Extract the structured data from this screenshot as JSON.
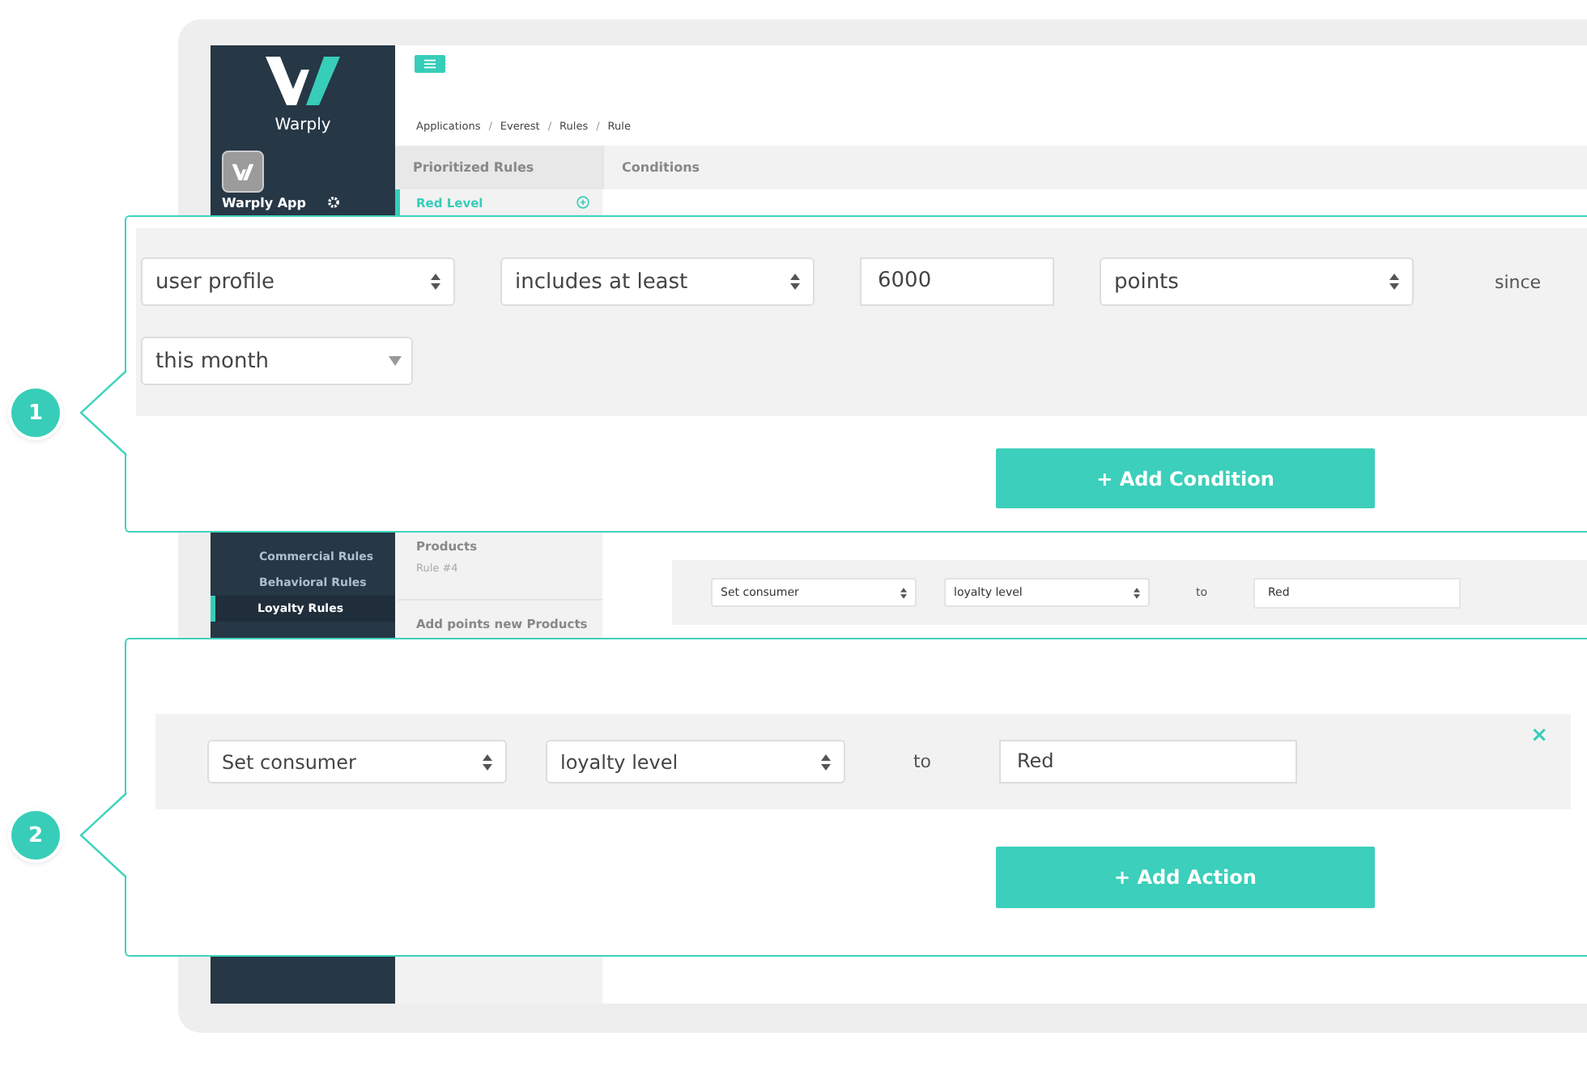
{
  "sidebar": {
    "brand": "Warply",
    "app": {
      "name": "Warply App"
    },
    "items": [
      {
        "label": "Commercial Rules",
        "selected": false
      },
      {
        "label": "Behavioral Rules",
        "selected": false
      },
      {
        "label": "Loyalty Rules",
        "selected": true
      }
    ]
  },
  "breadcrumb": {
    "separator": "/",
    "items": [
      "Applications",
      "Everest",
      "Rules",
      "Rule"
    ]
  },
  "rules_panel": {
    "title": "Prioritized Rules",
    "rules": [
      {
        "title": "Red Level",
        "selected": true
      },
      {
        "title": "Products",
        "subtitle": "Rule #4",
        "selected": false
      },
      {
        "title": "Add points new Products",
        "selected": false
      }
    ]
  },
  "conditions_panel": {
    "title": "Conditions",
    "action_row": [
      {
        "kind": "select",
        "value": "Set consumer"
      },
      {
        "kind": "select",
        "value": "loyalty level"
      },
      {
        "kind": "label",
        "text": "to"
      },
      {
        "kind": "input",
        "value": "Red"
      }
    ]
  },
  "callouts": [
    {
      "number": "1",
      "rows": [
        [
          {
            "kind": "select",
            "value": "user profile"
          },
          {
            "kind": "select",
            "value": "includes at least"
          },
          {
            "kind": "input",
            "value": "6000"
          },
          {
            "kind": "select",
            "value": "points"
          },
          {
            "kind": "label",
            "text": "since"
          }
        ],
        [
          {
            "kind": "dropdown",
            "value": "this month"
          }
        ]
      ],
      "button": "+ Add Condition"
    },
    {
      "number": "2",
      "rows": [
        [
          {
            "kind": "select",
            "value": "Set consumer"
          },
          {
            "kind": "select",
            "value": "loyalty level"
          },
          {
            "kind": "label",
            "text": "to"
          },
          {
            "kind": "input",
            "value": "Red"
          }
        ]
      ],
      "remove": "×",
      "button": "+ Add Action"
    }
  ]
}
